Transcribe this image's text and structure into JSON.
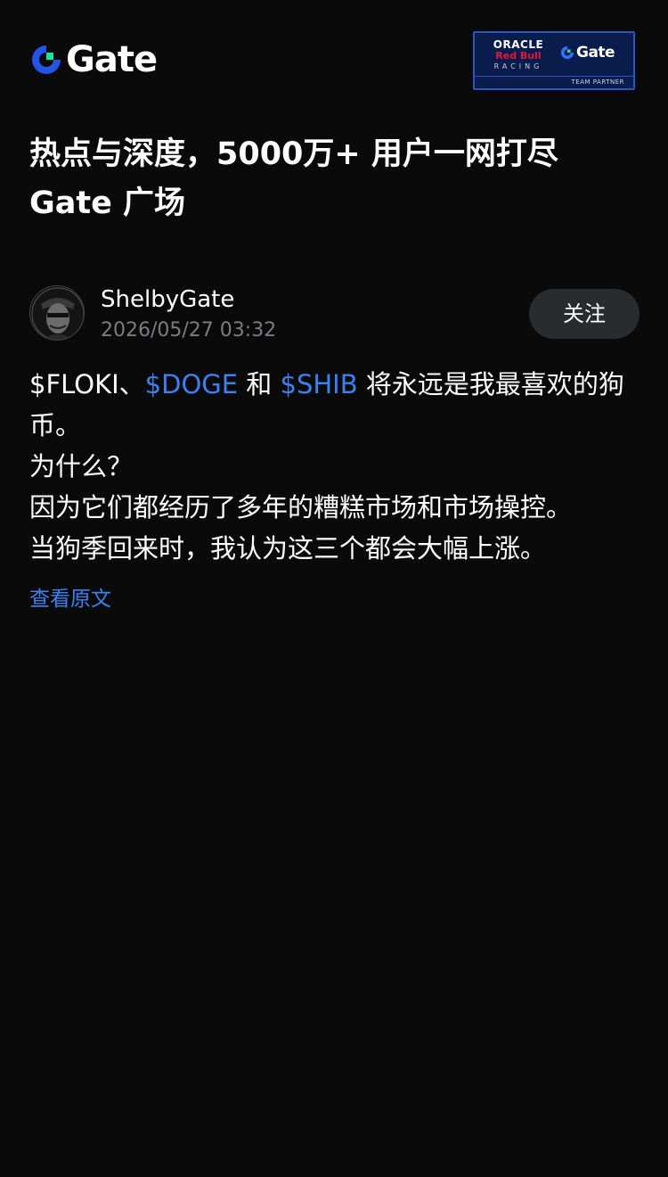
{
  "header": {
    "logo_text": "Gate",
    "logo_icon": "gate-logo-icon",
    "partner_badge": {
      "oracle": "ORACLE",
      "redbull": "Red Bull",
      "racing": "RACING",
      "gate": "Gate",
      "team_partner": "TEAM PARTNER"
    }
  },
  "headline": {
    "line1": "热点与深度，5000万+ 用户一网打尽",
    "line2": "Gate 广场"
  },
  "post": {
    "author": {
      "name": "ShelbyGate",
      "timestamp": "2026/05/27 03:32",
      "avatar_icon": "avatar-image"
    },
    "follow_label": "关注",
    "body": {
      "line1_prefix": "$FLOKI、",
      "ticker_doge": "$DOGE",
      "line1_mid": " 和 ",
      "ticker_shib": "$SHIB",
      "line1_suffix": "  将永远是我最喜欢的狗",
      "line2": "币。",
      "line3": "为什么？",
      "line4": "因为它们都经历了多年的糟糕市场和市场操控。",
      "line5": "当狗季回来时，我认为这三个都会大幅上涨。"
    },
    "view_original": "查看原文"
  },
  "colors": {
    "background": "#0a0a0b",
    "accent_blue": "#3a82f2",
    "muted_text": "#7c7c80",
    "button_bg": "#2a2b2e",
    "badge_bg": "#0a1c4c"
  }
}
